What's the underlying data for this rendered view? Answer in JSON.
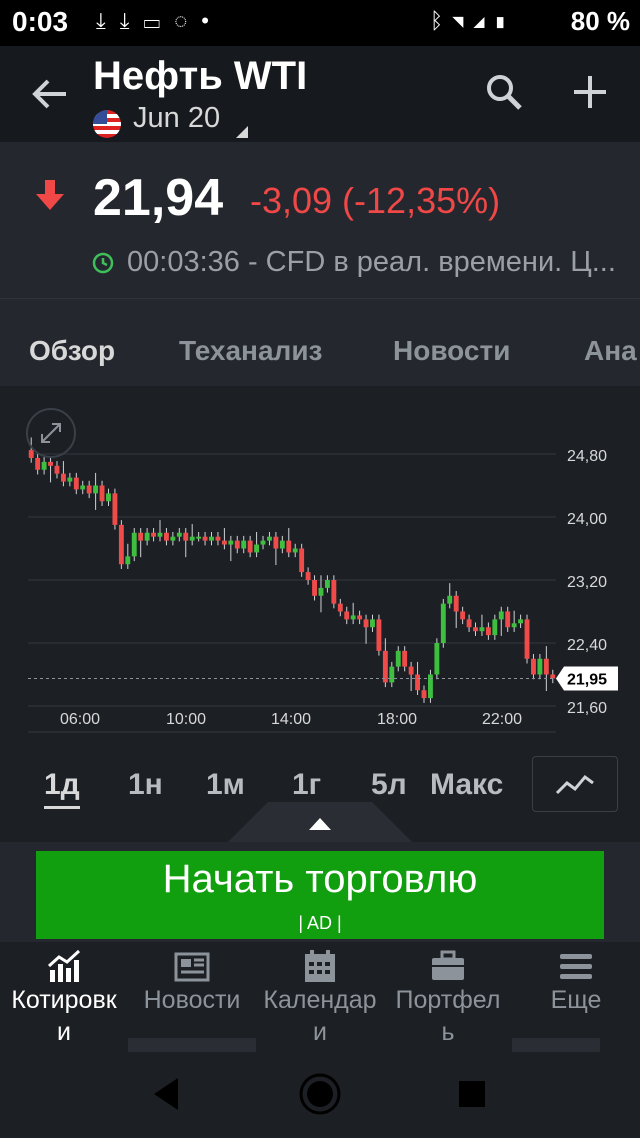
{
  "status_bar": {
    "time": "0:03",
    "left_icons": [
      "download-icon",
      "download-icon",
      "bed-icon",
      "bulb-icon",
      "dot-icon"
    ],
    "right_icons": [
      "bluetooth-icon",
      "wifi-icon",
      "signal-icon",
      "battery-icon"
    ],
    "battery": "80 %"
  },
  "header": {
    "title": "Нефть WTI",
    "expiry": "Jun 20"
  },
  "quote": {
    "price": "21,94",
    "change": "-3,09 (-12,35%)",
    "time": "00:03:36",
    "source": " - CFD в реал. времени. Ц...",
    "colors": {
      "down": "#f04747",
      "clock": "#3fbf5a"
    }
  },
  "tabs": [
    {
      "label": "Обзор",
      "active": true
    },
    {
      "label": "Теханализ",
      "active": false
    },
    {
      "label": "Новости",
      "active": false
    },
    {
      "label": "Ана",
      "active": false
    }
  ],
  "chart_data": {
    "type": "candlestick",
    "yticks": [
      "24,80",
      "24,00",
      "23,20",
      "22,40",
      "21,60"
    ],
    "xticks": [
      "06:00",
      "10:00",
      "14:00",
      "18:00",
      "22:00"
    ],
    "ylim": [
      21.6,
      24.8
    ],
    "last_price_label": "21,95",
    "last_price": 21.95,
    "colors": {
      "up": "#3fbf3f",
      "down": "#ef4b4b",
      "grid": "#33383f"
    },
    "series": [
      24.75,
      24.6,
      24.7,
      24.65,
      24.55,
      24.45,
      24.5,
      24.35,
      24.4,
      24.3,
      24.4,
      24.2,
      24.3,
      23.9,
      23.4,
      23.5,
      23.8,
      23.7,
      23.8,
      23.75,
      23.8,
      23.7,
      23.75,
      23.8,
      23.7,
      23.75,
      23.75,
      23.7,
      23.75,
      23.7,
      23.65,
      23.7,
      23.6,
      23.7,
      23.55,
      23.65,
      23.7,
      23.75,
      23.6,
      23.7,
      23.55,
      23.6,
      23.3,
      23.2,
      23.0,
      23.1,
      23.2,
      22.9,
      22.8,
      22.7,
      22.75,
      22.7,
      22.6,
      22.7,
      22.3,
      21.9,
      22.1,
      22.3,
      22.1,
      22.0,
      21.8,
      21.7,
      22.0,
      22.4,
      22.9,
      23.0,
      22.8,
      22.7,
      22.6,
      22.55,
      22.6,
      22.5,
      22.7,
      22.8,
      22.6,
      22.65,
      22.7,
      22.2,
      22.0,
      22.2,
      22.0,
      21.95
    ]
  },
  "ranges": [
    {
      "label": "1д",
      "active": true
    },
    {
      "label": "1н",
      "active": false
    },
    {
      "label": "1м",
      "active": false
    },
    {
      "label": "1г",
      "active": false
    },
    {
      "label": "5л",
      "active": false
    },
    {
      "label": "Макс",
      "active": false
    }
  ],
  "ad": {
    "text": "Начать торговлю",
    "tag": "| AD |",
    "color": "#119f0f"
  },
  "bottom_nav": [
    {
      "label": "Котировк\nи",
      "icon": "chart-icon",
      "active": true
    },
    {
      "label": "Новости",
      "icon": "newspaper-icon",
      "active": false
    },
    {
      "label": "Календар\nи",
      "icon": "calendar-icon",
      "active": false
    },
    {
      "label": "Портфел\nь",
      "icon": "briefcase-icon",
      "active": false
    },
    {
      "label": "Еще",
      "icon": "menu-icon",
      "active": false
    }
  ]
}
